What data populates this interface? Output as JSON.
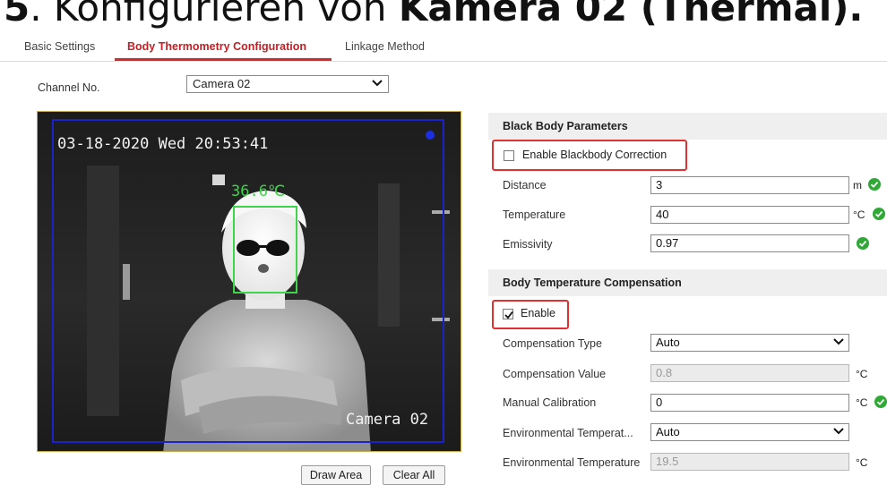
{
  "heading": {
    "step_number": "5",
    "text_regular": ". Konfigurieren von ",
    "text_bold": "Kamera 02 (Thermal)."
  },
  "tabs": [
    {
      "label": "Basic Settings",
      "active": false
    },
    {
      "label": "Body Thermometry Configuration",
      "active": true
    },
    {
      "label": "Linkage Method",
      "active": false
    }
  ],
  "channel": {
    "label": "Channel No.",
    "selected": "Camera 02"
  },
  "video": {
    "timestamp": "03-18-2020 Wed 20:53:41",
    "camera_name": "Camera 02",
    "detected_temperature": "36.6℃",
    "roi_color": "#1a22c8",
    "face_box_color": "#3fd44a"
  },
  "buttons": {
    "draw_area": "Draw Area",
    "clear_all": "Clear All"
  },
  "black_body": {
    "title": "Black Body Parameters",
    "enable_label": "Enable Blackbody Correction",
    "enable_checked": false,
    "fields": [
      {
        "label": "Distance",
        "value": "3",
        "unit": "m",
        "valid": true
      },
      {
        "label": "Temperature",
        "value": "40",
        "unit": "°C",
        "valid": true
      },
      {
        "label": "Emissivity",
        "value": "0.97",
        "unit": "",
        "valid": true
      }
    ]
  },
  "compensation": {
    "title": "Body Temperature Compensation",
    "enable_label": "Enable",
    "enable_checked": true,
    "fields": [
      {
        "label": "Compensation Type",
        "value": "Auto",
        "unit": "",
        "type": "select"
      },
      {
        "label": "Compensation Value",
        "value": "0.8",
        "unit": "°C",
        "type": "disabled"
      },
      {
        "label": "Manual Calibration",
        "value": "0",
        "unit": "°C",
        "type": "input",
        "valid": true
      },
      {
        "label": "Environmental Temperat...",
        "value": "Auto",
        "unit": "",
        "type": "select"
      },
      {
        "label": "Environmental Temperature",
        "value": "19.5",
        "unit": "°C",
        "type": "disabled"
      }
    ]
  },
  "colors": {
    "accent": "#c21f24",
    "highlight_box": "#e03030",
    "valid_icon": "#2fa836"
  }
}
